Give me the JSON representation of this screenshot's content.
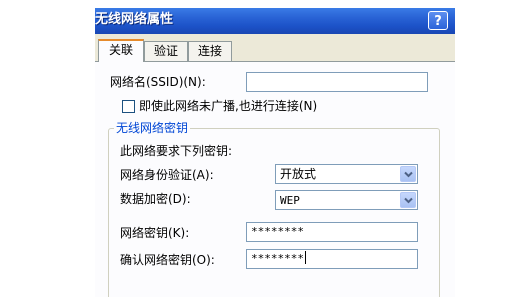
{
  "window": {
    "title": "无线网络属性",
    "help_label": "?"
  },
  "tabs": [
    {
      "label": "关联",
      "active": true
    },
    {
      "label": "验证",
      "active": false
    },
    {
      "label": "连接",
      "active": false
    }
  ],
  "form": {
    "ssid_label": "网络名(SSID)(N):",
    "ssid_value": "",
    "broadcast_checkbox_label": "即使此网络未广播,也进行连接(N)",
    "broadcast_checked": false,
    "group_title": "无线网络密钥",
    "requires_key_text": "此网络要求下列密钥:",
    "auth_label": "网络身份验证(A):",
    "auth_value": "开放式",
    "encryption_label": "数据加密(D):",
    "encryption_value": "WEP",
    "key_label": "网络密钥(K):",
    "key_value": "********",
    "confirm_label": "确认网络密钥(O):",
    "confirm_value": "********"
  },
  "colors": {
    "titlebar": "#2a64d6",
    "dialog_bg": "#ece9d8",
    "panel_bg": "#fcfcfe",
    "group_title": "#0046d5",
    "active_tab_accent": "#e68b2c"
  }
}
